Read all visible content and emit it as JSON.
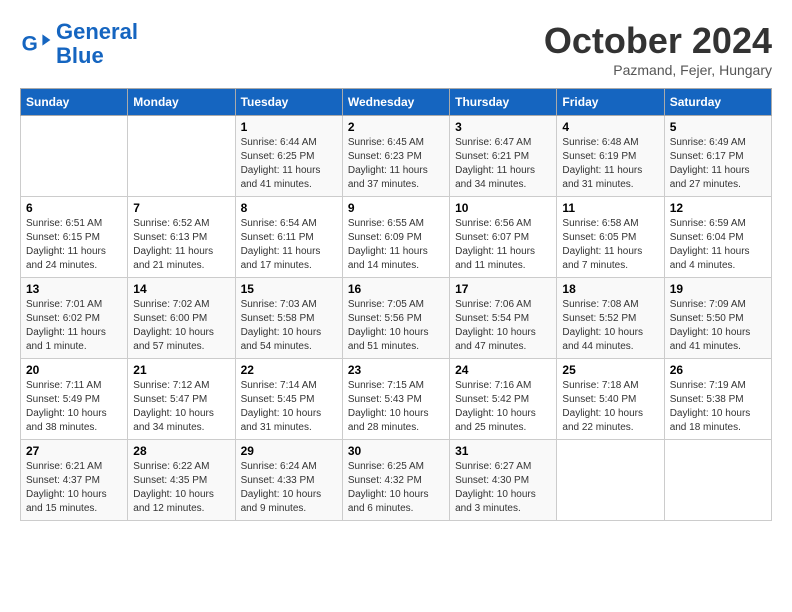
{
  "logo": {
    "line1": "General",
    "line2": "Blue"
  },
  "title": "October 2024",
  "subtitle": "Pazmand, Fejer, Hungary",
  "days_of_week": [
    "Sunday",
    "Monday",
    "Tuesday",
    "Wednesday",
    "Thursday",
    "Friday",
    "Saturday"
  ],
  "weeks": [
    [
      {
        "day": "",
        "info": ""
      },
      {
        "day": "",
        "info": ""
      },
      {
        "day": "1",
        "info": "Sunrise: 6:44 AM\nSunset: 6:25 PM\nDaylight: 11 hours and 41 minutes."
      },
      {
        "day": "2",
        "info": "Sunrise: 6:45 AM\nSunset: 6:23 PM\nDaylight: 11 hours and 37 minutes."
      },
      {
        "day": "3",
        "info": "Sunrise: 6:47 AM\nSunset: 6:21 PM\nDaylight: 11 hours and 34 minutes."
      },
      {
        "day": "4",
        "info": "Sunrise: 6:48 AM\nSunset: 6:19 PM\nDaylight: 11 hours and 31 minutes."
      },
      {
        "day": "5",
        "info": "Sunrise: 6:49 AM\nSunset: 6:17 PM\nDaylight: 11 hours and 27 minutes."
      }
    ],
    [
      {
        "day": "6",
        "info": "Sunrise: 6:51 AM\nSunset: 6:15 PM\nDaylight: 11 hours and 24 minutes."
      },
      {
        "day": "7",
        "info": "Sunrise: 6:52 AM\nSunset: 6:13 PM\nDaylight: 11 hours and 21 minutes."
      },
      {
        "day": "8",
        "info": "Sunrise: 6:54 AM\nSunset: 6:11 PM\nDaylight: 11 hours and 17 minutes."
      },
      {
        "day": "9",
        "info": "Sunrise: 6:55 AM\nSunset: 6:09 PM\nDaylight: 11 hours and 14 minutes."
      },
      {
        "day": "10",
        "info": "Sunrise: 6:56 AM\nSunset: 6:07 PM\nDaylight: 11 hours and 11 minutes."
      },
      {
        "day": "11",
        "info": "Sunrise: 6:58 AM\nSunset: 6:05 PM\nDaylight: 11 hours and 7 minutes."
      },
      {
        "day": "12",
        "info": "Sunrise: 6:59 AM\nSunset: 6:04 PM\nDaylight: 11 hours and 4 minutes."
      }
    ],
    [
      {
        "day": "13",
        "info": "Sunrise: 7:01 AM\nSunset: 6:02 PM\nDaylight: 11 hours and 1 minute."
      },
      {
        "day": "14",
        "info": "Sunrise: 7:02 AM\nSunset: 6:00 PM\nDaylight: 10 hours and 57 minutes."
      },
      {
        "day": "15",
        "info": "Sunrise: 7:03 AM\nSunset: 5:58 PM\nDaylight: 10 hours and 54 minutes."
      },
      {
        "day": "16",
        "info": "Sunrise: 7:05 AM\nSunset: 5:56 PM\nDaylight: 10 hours and 51 minutes."
      },
      {
        "day": "17",
        "info": "Sunrise: 7:06 AM\nSunset: 5:54 PM\nDaylight: 10 hours and 47 minutes."
      },
      {
        "day": "18",
        "info": "Sunrise: 7:08 AM\nSunset: 5:52 PM\nDaylight: 10 hours and 44 minutes."
      },
      {
        "day": "19",
        "info": "Sunrise: 7:09 AM\nSunset: 5:50 PM\nDaylight: 10 hours and 41 minutes."
      }
    ],
    [
      {
        "day": "20",
        "info": "Sunrise: 7:11 AM\nSunset: 5:49 PM\nDaylight: 10 hours and 38 minutes."
      },
      {
        "day": "21",
        "info": "Sunrise: 7:12 AM\nSunset: 5:47 PM\nDaylight: 10 hours and 34 minutes."
      },
      {
        "day": "22",
        "info": "Sunrise: 7:14 AM\nSunset: 5:45 PM\nDaylight: 10 hours and 31 minutes."
      },
      {
        "day": "23",
        "info": "Sunrise: 7:15 AM\nSunset: 5:43 PM\nDaylight: 10 hours and 28 minutes."
      },
      {
        "day": "24",
        "info": "Sunrise: 7:16 AM\nSunset: 5:42 PM\nDaylight: 10 hours and 25 minutes."
      },
      {
        "day": "25",
        "info": "Sunrise: 7:18 AM\nSunset: 5:40 PM\nDaylight: 10 hours and 22 minutes."
      },
      {
        "day": "26",
        "info": "Sunrise: 7:19 AM\nSunset: 5:38 PM\nDaylight: 10 hours and 18 minutes."
      }
    ],
    [
      {
        "day": "27",
        "info": "Sunrise: 6:21 AM\nSunset: 4:37 PM\nDaylight: 10 hours and 15 minutes."
      },
      {
        "day": "28",
        "info": "Sunrise: 6:22 AM\nSunset: 4:35 PM\nDaylight: 10 hours and 12 minutes."
      },
      {
        "day": "29",
        "info": "Sunrise: 6:24 AM\nSunset: 4:33 PM\nDaylight: 10 hours and 9 minutes."
      },
      {
        "day": "30",
        "info": "Sunrise: 6:25 AM\nSunset: 4:32 PM\nDaylight: 10 hours and 6 minutes."
      },
      {
        "day": "31",
        "info": "Sunrise: 6:27 AM\nSunset: 4:30 PM\nDaylight: 10 hours and 3 minutes."
      },
      {
        "day": "",
        "info": ""
      },
      {
        "day": "",
        "info": ""
      }
    ]
  ]
}
